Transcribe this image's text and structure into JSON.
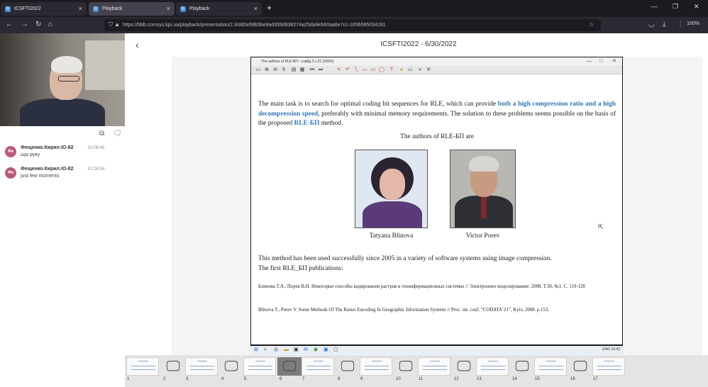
{
  "browser": {
    "tabs": [
      {
        "label": "ICSFTI2022",
        "favicon": "B"
      },
      {
        "label": "Playback",
        "favicon": "B"
      },
      {
        "label": "Playback",
        "favicon": "B"
      }
    ],
    "url": "https://bbb.comsys.kpi.ua/playback/presentation/2.3/dd0e58b5be8ad359d838274a25da9eb60aa6e7cc-1656595034281",
    "zoom": "100%"
  },
  "header": {
    "title": "ICSFTI2022 - 6/30/2022"
  },
  "chat": {
    "messages": [
      {
        "user": "Фещенко.Кирил.ІО-82",
        "avatar": "Фе",
        "time": "01:08:45",
        "text": "щш руку"
      },
      {
        "user": "Фещенко.Кирил.ІО-82",
        "avatar": "Фе",
        "time": "01:28:54",
        "text": "just few moments"
      }
    ]
  },
  "document": {
    "window_title": "The authors of RLE-БП - слайд 3 з 21 [100%]",
    "intro_a": "The main task is to search for optimal coding bit sequences for RLE, which can provide ",
    "intro_b": "both a high compression ratio and a high decompression speed",
    "intro_c": ", preferably with minimal memory requirements. The solution to these problems seems possible on the basis of the proposed ",
    "intro_d": "RLE-БП",
    "intro_e": " method.",
    "authors_heading": "The authors of  RLE-БП are",
    "author1": "Tatyana Blinova",
    "author2": "Victor Porev",
    "usage_line1": "This method has been used successfully since 2005 in a variety of software systems using image compression.",
    "usage_line2": "The first RLE_БП publications:",
    "ref1": "Блинова Т.А., Порев В.Н. Некоторые способы кодирования растров в геоинформационных системах // Электронное моделирование. 2008. Т.30, №1. С. 119-128",
    "ref2": "Blinova T., Porev V. Some Methods Of The Raster Encoding In Geographic Information Systems // Proc. int. conf. “CODATA`21”, Kyiv, 2008. p.153."
  },
  "taskbar": {
    "tray": "ENG  16:43"
  },
  "thumbnails": {
    "numbers": [
      "1",
      "2",
      "3",
      "4",
      "5",
      "6",
      "7",
      "8",
      "9",
      "10",
      "11",
      "12",
      "13",
      "14",
      "15",
      "16",
      "17"
    ]
  },
  "colors": {
    "accent_blue": "#2f75b5",
    "browser_dark": "#1c1b22"
  }
}
